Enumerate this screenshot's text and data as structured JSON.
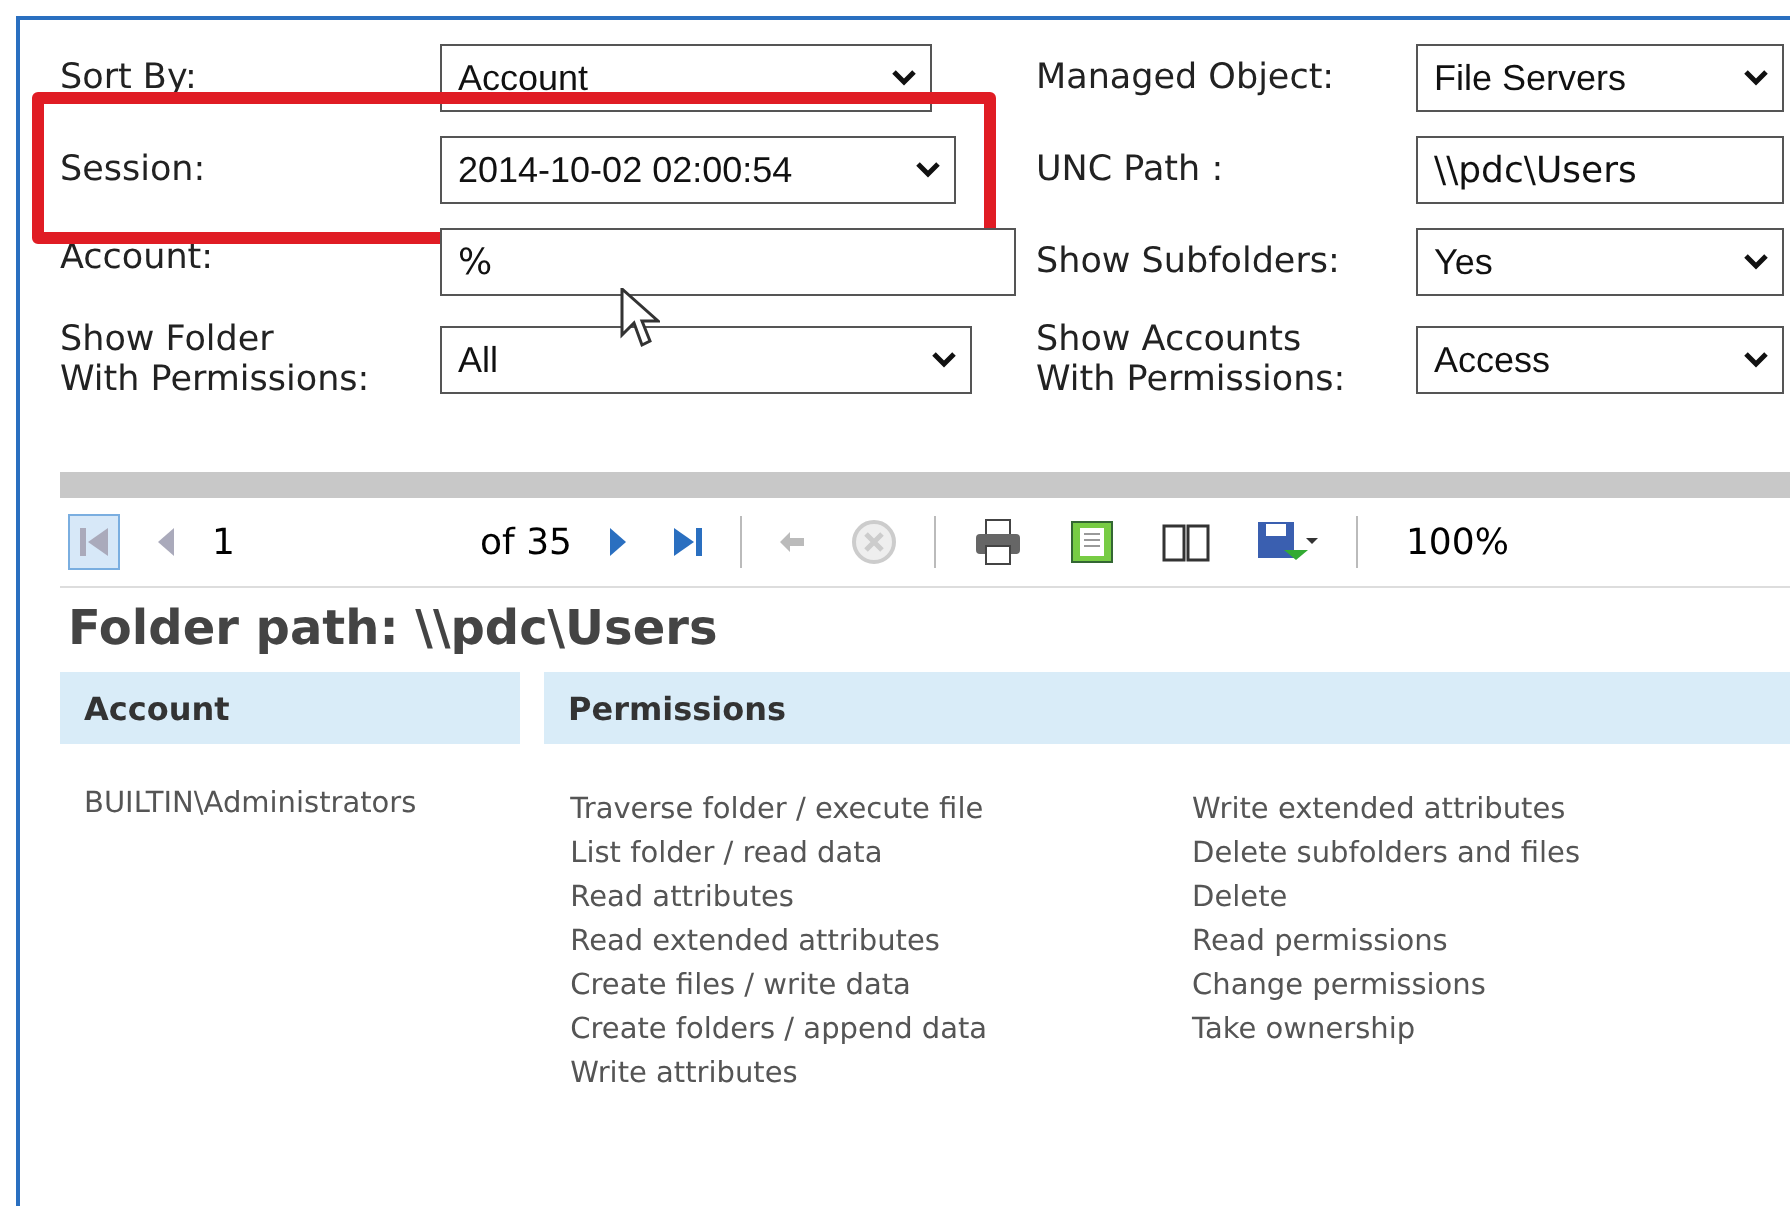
{
  "filters_left": [
    {
      "label": "Sort By:",
      "kind": "select",
      "value": "Account",
      "highlighted": false
    },
    {
      "label": "Session:",
      "kind": "select",
      "value": "2014-10-02 02:00:54",
      "highlighted": true
    },
    {
      "label": "Account:",
      "kind": "text",
      "value": "%",
      "highlighted": false
    },
    {
      "label": "Show Folder\nWith Permissions:",
      "kind": "select",
      "value": "All",
      "highlighted": false
    }
  ],
  "filters_right": [
    {
      "label": "Managed Object:",
      "kind": "select",
      "value": "File Servers"
    },
    {
      "label": "UNC Path :",
      "kind": "text",
      "value": "\\\\pdc\\Users"
    },
    {
      "label": "Show Subfolders:",
      "kind": "select",
      "value": "Yes"
    },
    {
      "label": "Show Accounts\nWith Permissions:",
      "kind": "select",
      "value": "Access"
    }
  ],
  "toolbar": {
    "page": "1",
    "page_count": "of 35",
    "zoom": "100%",
    "buttons": [
      {
        "kind": "first",
        "disabled": true
      },
      {
        "kind": "prev",
        "disabled": true
      },
      {
        "kind": "page"
      },
      {
        "kind": "next",
        "disabled": false
      },
      {
        "kind": "last",
        "disabled": false
      },
      {
        "kind": "sep"
      },
      {
        "kind": "back",
        "disabled": true
      },
      {
        "kind": "stop",
        "disabled": true
      },
      {
        "kind": "sep"
      },
      {
        "kind": "print"
      },
      {
        "kind": "layout"
      },
      {
        "kind": "setup"
      },
      {
        "kind": "export"
      },
      {
        "kind": "sep"
      },
      {
        "kind": "zoom"
      }
    ]
  },
  "report": {
    "heading": "Folder path: \\\\pdc\\Users",
    "columns": [
      "Account",
      "Permissions"
    ],
    "rows": [
      {
        "account": "BUILTIN\\Administrators",
        "permissions": [
          [
            "Traverse folder / execute file",
            "List folder / read data",
            "Read attributes",
            "Read extended attributes",
            "Create files / write data",
            "Create folders / append data",
            "Write attributes"
          ],
          [
            "Write extended attributes",
            "Delete subfolders and files",
            "Delete",
            "Read permissions",
            "Change permissions",
            "Take ownership"
          ]
        ]
      }
    ]
  }
}
